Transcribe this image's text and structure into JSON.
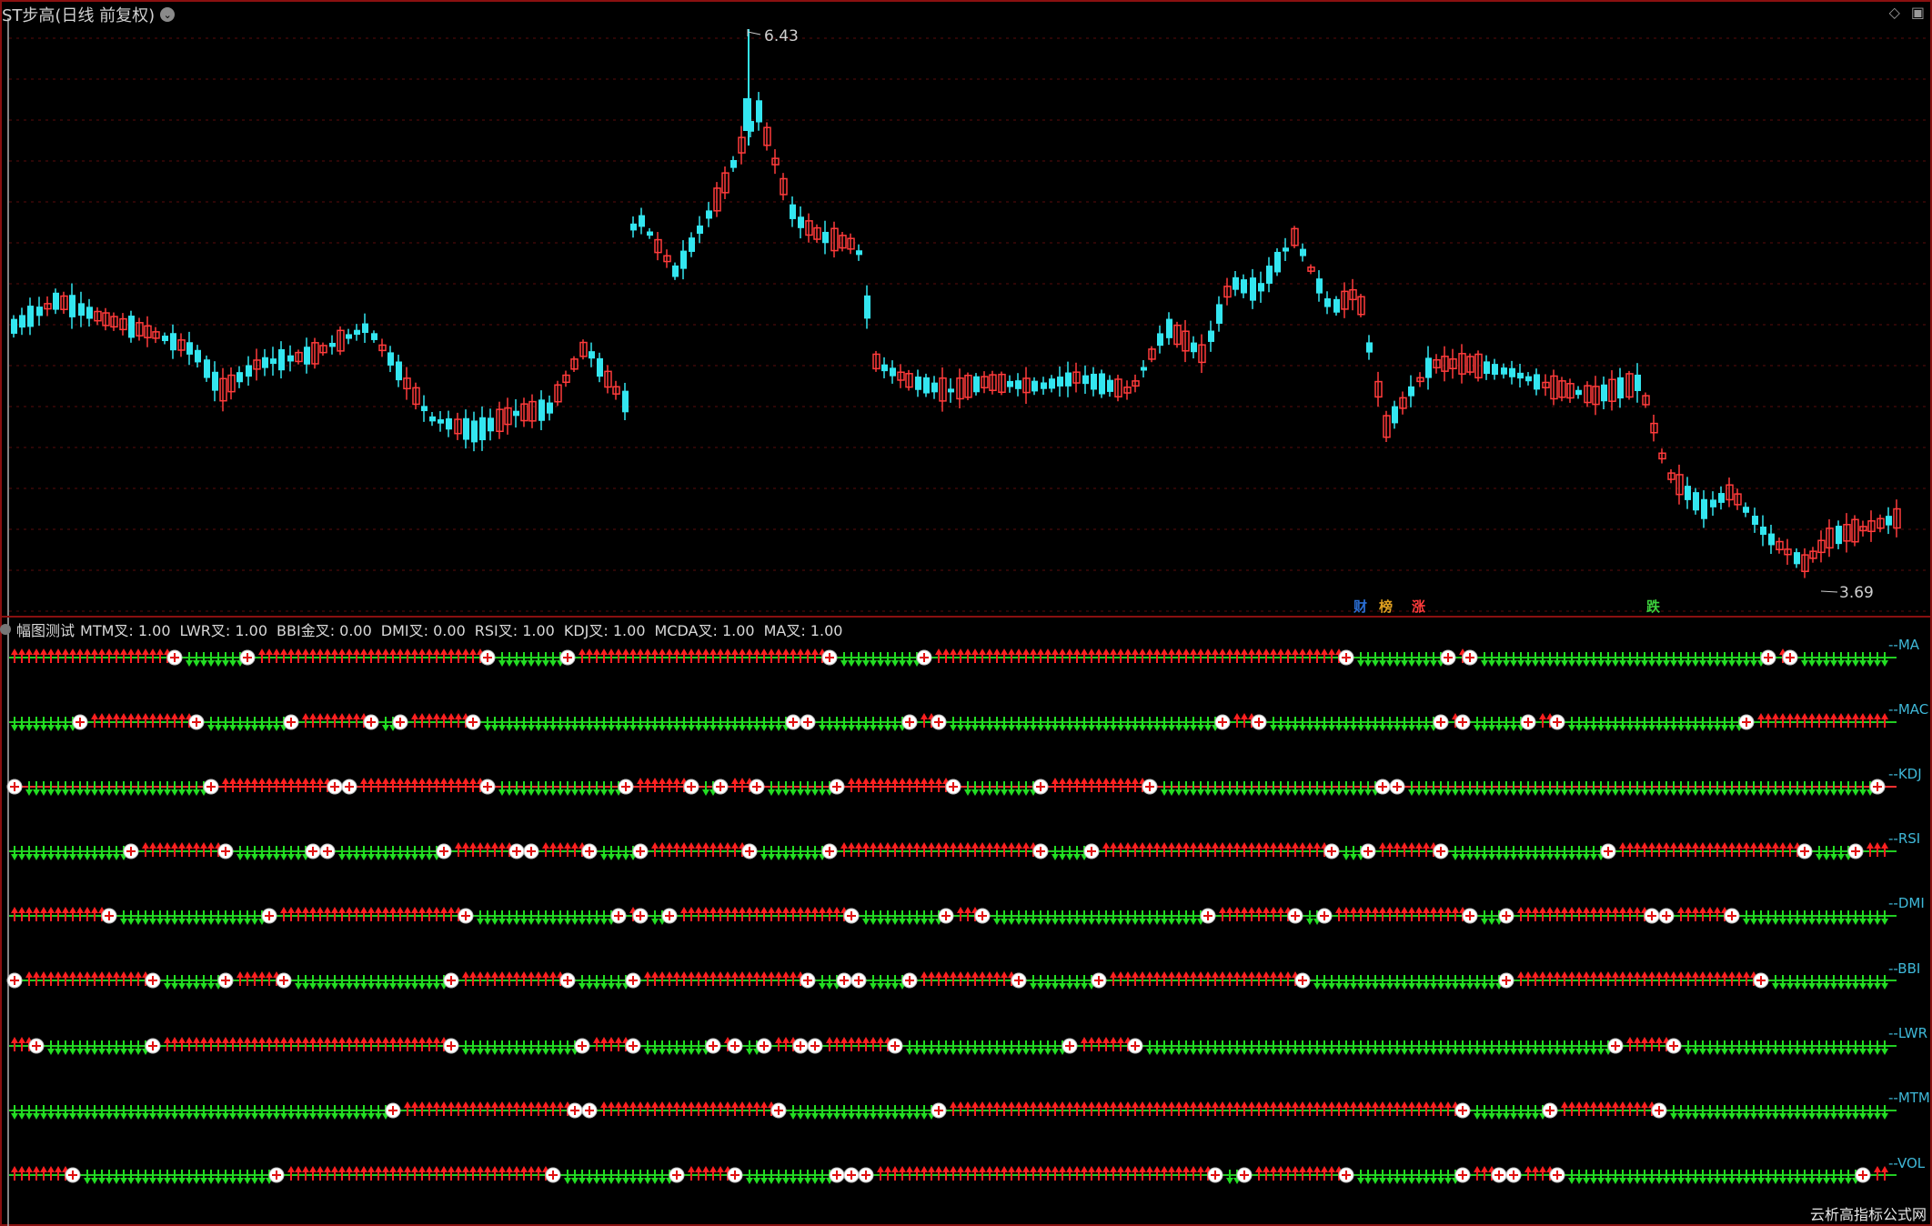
{
  "window": {
    "title": "ST步高(日线 前复权)",
    "dropdown_icon": "chevron-down-icon",
    "buttons": [
      "diamond-icon",
      "window-icon"
    ]
  },
  "price_chart": {
    "high_label": "6.43",
    "low_label": "3.69",
    "up_color": "#ff3b3b",
    "down_color": "#33e6f0",
    "grid_color": "#6a1010",
    "badges": [
      {
        "text": "财",
        "color": "#2a6fd6"
      },
      {
        "text": "榜",
        "color": "#e0a020"
      },
      {
        "text": "涨",
        "color": "#ff3b3b"
      },
      {
        "text": "跌",
        "color": "#3ccf3c"
      }
    ]
  },
  "indicator_panel": {
    "name": "幅图测试",
    "items": [
      {
        "label": "MTM叉: 1.00"
      },
      {
        "label": "LWR叉: 1.00"
      },
      {
        "label": "BBI金叉: 0.00"
      },
      {
        "label": "DMI叉: 0.00"
      },
      {
        "label": "RSI叉: 1.00"
      },
      {
        "label": "KDJ叉: 1.00"
      },
      {
        "label": "MCDA叉: 1.00"
      },
      {
        "label": "MA叉: 1.00"
      }
    ],
    "rows": [
      {
        "label": "--MA"
      },
      {
        "label": "--MAC"
      },
      {
        "label": "--KDJ"
      },
      {
        "label": "--RSI"
      },
      {
        "label": "--DMI"
      },
      {
        "label": "--BBI"
      },
      {
        "label": "--LWR"
      },
      {
        "label": "--MTM"
      },
      {
        "label": "--VOL"
      }
    ],
    "signal_up_color": "#ff2020",
    "signal_down_color": "#22dd22"
  },
  "watermark": "云析高指标公式网"
}
